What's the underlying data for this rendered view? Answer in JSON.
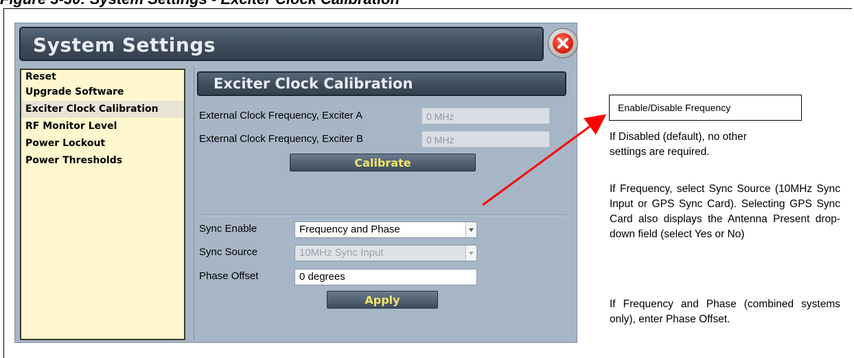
{
  "figure": {
    "caption": "Figure 3-30: System Settings - Exciter Clock Calibration"
  },
  "window": {
    "title": "System Settings"
  },
  "sidebar": {
    "items": [
      {
        "label": "Reset"
      },
      {
        "label": "Upgrade Software"
      },
      {
        "label": "Exciter Clock Calibration",
        "selected": true
      },
      {
        "label": "RF Monitor Level"
      },
      {
        "label": "Power Lockout"
      },
      {
        "label": "Power Thresholds"
      }
    ]
  },
  "panel": {
    "title": "Exciter Clock Calibration",
    "ext_a_label": "External Clock Frequency, Exciter A",
    "ext_a_value": "0 MHz",
    "ext_b_label": "External Clock Frequency, Exciter B",
    "ext_b_value": "0 MHz",
    "calibrate_label": "Calibrate",
    "sync_enable_label": "Sync Enable",
    "sync_enable_value": "Frequency and Phase",
    "sync_source_label": "Sync Source",
    "sync_source_value": "10MHz Sync Input",
    "phase_offset_label": "Phase Offset",
    "phase_offset_value": "0 degrees",
    "apply_label": "Apply"
  },
  "annotation": {
    "callout": "Enable/Disable Frequency",
    "para1_line1": "If Disabled (default), no other",
    "para1_line2": "settings are required.",
    "para2": "If Frequency, select Sync Source (10MHz Sync Input or GPS Sync Card). Selecting GPS Sync Card also displays the Antenna Present drop-down field (select Yes or No)",
    "para3": "If Frequency and Phase (combined systems only), enter Phase Offset.",
    "arrow_color": "#ff0000"
  },
  "colors": {
    "header_bg": "#3d4b5b",
    "screen_bg": "#a7b6c6",
    "sidebar_bg": "#fff8cf",
    "button_text": "#f2e56a"
  }
}
